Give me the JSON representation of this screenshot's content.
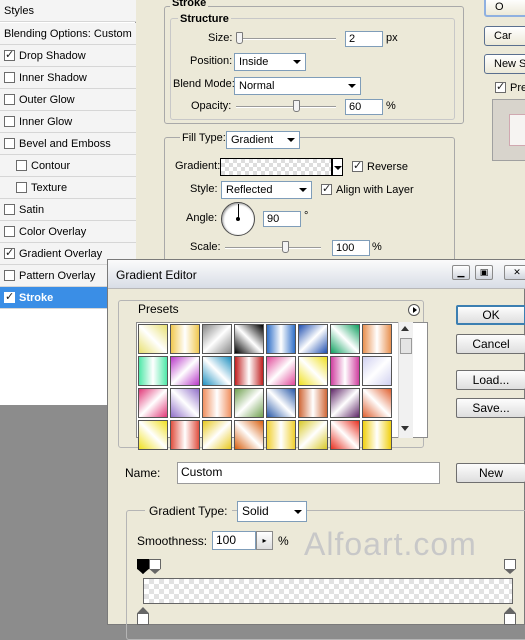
{
  "layer_style": {
    "styles_header": "Styles",
    "blending_options": "Blending Options: Custom",
    "style_items": [
      {
        "label": "Drop Shadow",
        "checked": true,
        "indent": false
      },
      {
        "label": "Inner Shadow",
        "checked": false,
        "indent": false
      },
      {
        "label": "Outer Glow",
        "checked": false,
        "indent": false
      },
      {
        "label": "Inner Glow",
        "checked": false,
        "indent": false
      },
      {
        "label": "Bevel and Emboss",
        "checked": false,
        "indent": false
      },
      {
        "label": "Contour",
        "checked": false,
        "indent": true
      },
      {
        "label": "Texture",
        "checked": false,
        "indent": true
      },
      {
        "label": "Satin",
        "checked": false,
        "indent": false
      },
      {
        "label": "Color Overlay",
        "checked": false,
        "indent": false
      },
      {
        "label": "Gradient Overlay",
        "checked": true,
        "indent": false
      },
      {
        "label": "Pattern Overlay",
        "checked": false,
        "indent": false
      },
      {
        "label": "Stroke",
        "checked": true,
        "indent": false,
        "selected": true
      }
    ],
    "stroke_title": "Stroke",
    "structure_title": "Structure",
    "size_label": "Size:",
    "size_value": "2",
    "size_unit": "px",
    "position_label": "Position:",
    "position_value": "Inside",
    "blend_mode_label": "Blend Mode:",
    "blend_mode_value": "Normal",
    "opacity_label": "Opacity:",
    "opacity_value": "60",
    "opacity_unit": "%",
    "fill_type_label": "Fill Type:",
    "fill_type_value": "Gradient",
    "gradient_label": "Gradient:",
    "reverse_label": "Reverse",
    "reverse_checked": true,
    "style_label": "Style:",
    "style_value": "Reflected",
    "align_label": "Align with Layer",
    "align_checked": true,
    "angle_label": "Angle:",
    "angle_value": "90",
    "angle_unit": "°",
    "scale_label": "Scale:",
    "scale_value": "100",
    "scale_unit": "%",
    "ok_label": "O",
    "cancel_label": "Car",
    "new_style_label": "New S",
    "preview_label": "Pre",
    "preview_checked": true
  },
  "gradient_editor": {
    "title": "Gradient Editor",
    "presets_label": "Presets",
    "ok_label": "OK",
    "cancel_label": "Cancel",
    "load_label": "Load...",
    "save_label": "Save...",
    "name_label": "Name:",
    "name_value": "Custom",
    "new_label": "New",
    "gradient_type_label": "Gradient Type:",
    "gradient_type_value": "Solid",
    "smoothness_label": "Smoothness:",
    "smoothness_value": "100",
    "smoothness_unit": "%"
  },
  "watermark": "Alfoart.com",
  "preset_swatches": [
    [
      "#e8e070",
      "#f0c850",
      "#888888",
      "#000000",
      "#3070c8",
      "#2050b0",
      "#10a060",
      "#e89050"
    ],
    [
      "#50e8a8",
      "#b838c8",
      "#2090c0",
      "#c02020",
      "#e04898",
      "#f0e020",
      "#d040a0",
      "#d0d0f0"
    ],
    [
      "#e03878",
      "#9070c8",
      "#f09060",
      "#70a050",
      "#2858a8",
      "#d06838",
      "#602868",
      "#e06030"
    ],
    [
      "#f0e020",
      "#e05040",
      "#e8c820",
      "#d86010",
      "#f0d030",
      "#d8c828",
      "#e83020",
      "#f0d010"
    ]
  ]
}
